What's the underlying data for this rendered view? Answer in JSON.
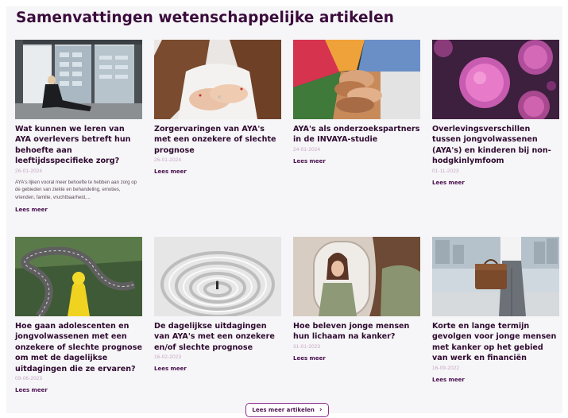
{
  "section": {
    "title": "Samenvattingen wetenschappelijke artikelen"
  },
  "articles": [
    {
      "title": "Wat kunnen we leren van AYA overlevers betreft hun behoefte aan leeftijdsspecifieke zorg?",
      "date": "26-01-2024",
      "excerpt": "AYA's lijken vooral meer behoefte te hebben aan zorg op de gebieden van ziekte en behandeling, emoties, vrienden, familie, vruchtbaarheid,...",
      "more": "Lees meer",
      "image": "woman-sitting-window-photo"
    },
    {
      "title": "Zorgervaringen van AYA's met een onzekere of slechte prognose",
      "date": "26-01-2024",
      "excerpt": "",
      "more": "Lees meer",
      "image": "hands-on-chest-photo"
    },
    {
      "title": "AYA's als onderzoekspartners in de INVAYA-studie",
      "date": "24-01-2024",
      "excerpt": "",
      "more": "Lees meer",
      "image": "stacked-hands-photo"
    },
    {
      "title": "Overlevingsverschillen tussen jongvolwassenen (AYA's) en kinderen bij non-hodgkinlymfoom",
      "date": "01-11-2023",
      "excerpt": "",
      "more": "Lees meer",
      "image": "cancer-cells-photo"
    },
    {
      "title": "Hoe gaan adolescenten en jongvolwassenen met een onzekere of slechte prognose om met de dagelijkse uitdagingen die ze ervaren?",
      "date": "09-06-2023",
      "excerpt": "",
      "more": "Lees meer",
      "image": "winding-road-figure-photo"
    },
    {
      "title": "De dagelijkse uitdagingen van AYA's met een onzekere en/of slechte prognose",
      "date": "16-02-2023",
      "excerpt": "",
      "more": "Lees meer",
      "image": "maze-photo"
    },
    {
      "title": "Hoe beleven jonge mensen hun lichaam na kanker?",
      "date": "31-01-2023",
      "excerpt": "",
      "more": "Lees meer",
      "image": "woman-mirror-photo"
    },
    {
      "title": "Korte en lange termijn gevolgen voor jonge mensen met kanker op het gebied van werk en financiën",
      "date": "16-09-2022",
      "excerpt": "",
      "more": "Lees meer",
      "image": "businessman-briefcase-photo"
    }
  ],
  "footer": {
    "more_articles_label": "Lees meer artikelen",
    "chevron_icon": "chevron-right-icon"
  },
  "colors": {
    "heading": "#3a0b3c",
    "date": "#c7a7c9",
    "accent": "#8c2f8f",
    "background": "#f6f5f7"
  }
}
